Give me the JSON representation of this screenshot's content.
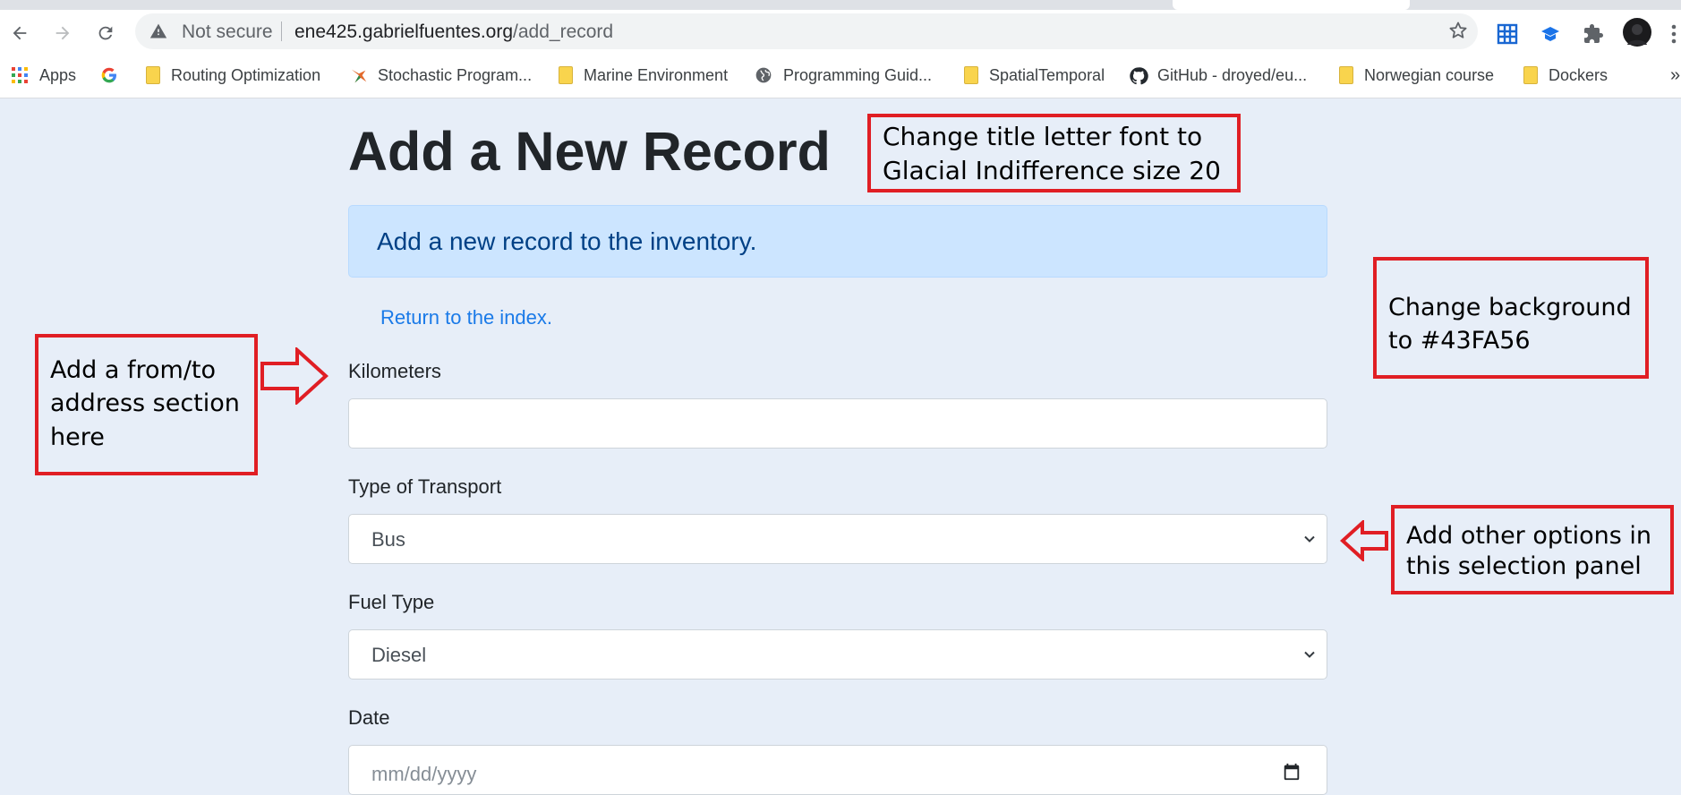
{
  "browser": {
    "security_label": "Not secure",
    "url_host": "ene425.gabrielfuentes.org",
    "url_path": "/add_record",
    "icons": [
      "back-icon",
      "forward-icon",
      "reload-icon",
      "warning-icon",
      "star-icon",
      "grid-extension-icon",
      "cap-extension-icon",
      "puzzle-icon",
      "profile-avatar",
      "menu-icon"
    ]
  },
  "bookmarks": [
    {
      "label": "Apps",
      "icon": "apps-grid-icon"
    },
    {
      "label": "",
      "icon": "google-icon"
    },
    {
      "label": "Routing Optimization",
      "icon": "folder-icon"
    },
    {
      "label": "Stochastic Program...",
      "icon": "bird-icon"
    },
    {
      "label": "Marine Environment",
      "icon": "folder-icon"
    },
    {
      "label": "Programming Guid...",
      "icon": "globe-icon"
    },
    {
      "label": "SpatialTemporal",
      "icon": "folder-icon"
    },
    {
      "label": "GitHub - droyed/eu...",
      "icon": "github-icon"
    },
    {
      "label": "Norwegian course",
      "icon": "folder-icon"
    },
    {
      "label": "Dockers",
      "icon": "folder-icon"
    }
  ],
  "bookmarks_overflow": "»",
  "page": {
    "title": "Add a New Record",
    "alert": "Add a new record to the inventory.",
    "back_link": "Return to the index.",
    "kilometers": {
      "label": "Kilometers",
      "value": ""
    },
    "transport": {
      "label": "Type of Transport",
      "selected": "Bus"
    },
    "fuel": {
      "label": "Fuel Type",
      "selected": "Diesel"
    },
    "date": {
      "label": "Date",
      "placeholder": "mm/dd/yyyy"
    }
  },
  "annotations": {
    "title_font": "Change title letter font to Glacial Indifference size 20",
    "background": "Change background to #43FA56",
    "address": "Add a from/to address section here",
    "options": "Add other options in this selection panel"
  },
  "colors": {
    "page_background": "#e7eef8",
    "alert_background": "#cce5ff",
    "alert_text": "#004085",
    "link": "#1a7ae8",
    "annotation_red": "#e01e24"
  }
}
